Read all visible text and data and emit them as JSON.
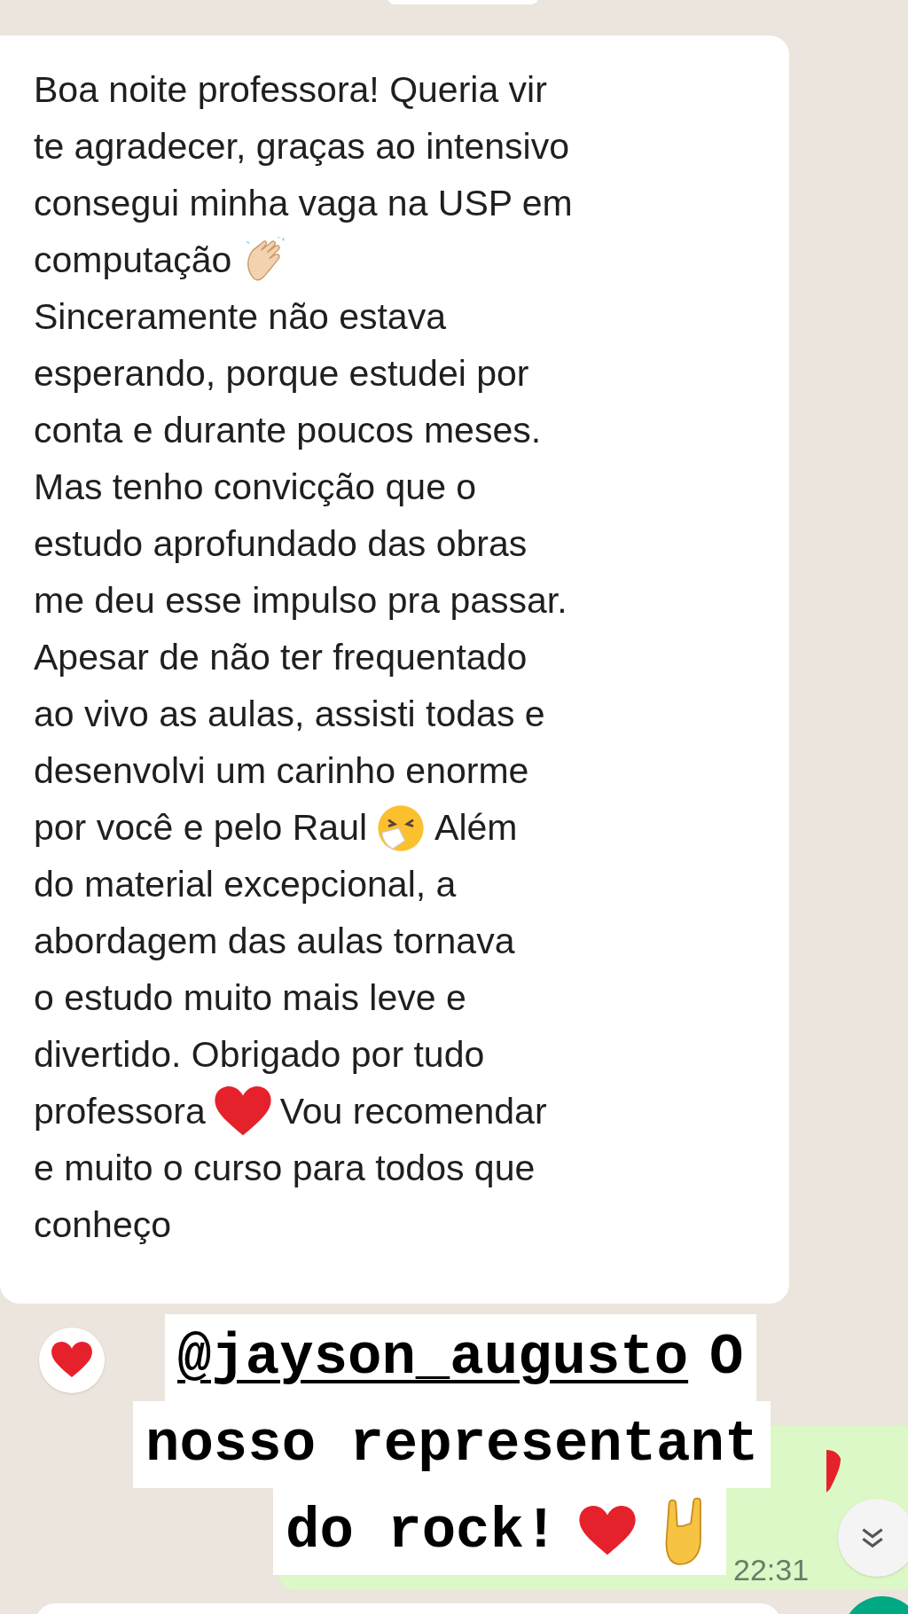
{
  "message": {
    "lines": [
      [
        {
          "kind": "text",
          "text": "Boa noite professora! Queria vir"
        }
      ],
      [
        {
          "kind": "text",
          "text": "te agradecer, graças ao intensivo"
        }
      ],
      [
        {
          "kind": "text",
          "text": "consegui minha vaga na USP em"
        }
      ],
      [
        {
          "kind": "text",
          "text": "computação"
        },
        {
          "kind": "clap"
        }
      ],
      [
        {
          "kind": "text",
          "text": "Sinceramente não estava"
        }
      ],
      [
        {
          "kind": "text",
          "text": "esperando, porque estudei por"
        }
      ],
      [
        {
          "kind": "text",
          "text": "conta e durante poucos meses."
        }
      ],
      [
        {
          "kind": "text",
          "text": "Mas tenho convicção que o"
        }
      ],
      [
        {
          "kind": "text",
          "text": "estudo aprofundado das obras"
        }
      ],
      [
        {
          "kind": "text",
          "text": "me deu esse impulso pra passar."
        }
      ],
      [
        {
          "kind": "text",
          "text": "Apesar de não ter frequentado"
        }
      ],
      [
        {
          "kind": "text",
          "text": "ao vivo as aulas, assisti todas e"
        }
      ],
      [
        {
          "kind": "text",
          "text": "desenvolvi um carinho enorme"
        }
      ],
      [
        {
          "kind": "text",
          "text": "por você e pelo Raul"
        },
        {
          "kind": "sneeze"
        },
        {
          "kind": "text",
          "text": "Além"
        }
      ],
      [
        {
          "kind": "text",
          "text": "do material excepcional, a"
        }
      ],
      [
        {
          "kind": "text",
          "text": "abordagem das aulas tornava"
        }
      ],
      [
        {
          "kind": "text",
          "text": "o estudo muito mais leve e"
        }
      ],
      [
        {
          "kind": "text",
          "text": "divertido. Obrigado por tudo"
        }
      ],
      [
        {
          "kind": "text",
          "text": "professora"
        },
        {
          "kind": "heart"
        },
        {
          "kind": "text",
          "text": "Vou recomendar"
        }
      ],
      [
        {
          "kind": "text",
          "text": "e muito o curso para todos que"
        }
      ],
      [
        {
          "kind": "text",
          "text": "conheço"
        }
      ]
    ]
  },
  "reply": {
    "time": "22:31"
  },
  "sticker": {
    "lines": [
      [
        {
          "kind": "mention",
          "text": "@jayson_augusto"
        },
        {
          "kind": "text",
          "text": "O"
        }
      ],
      [
        {
          "kind": "text",
          "text": "nosso representant"
        }
      ],
      [
        {
          "kind": "text",
          "text": "do rock!"
        },
        {
          "kind": "heart"
        },
        {
          "kind": "rock"
        }
      ]
    ]
  }
}
